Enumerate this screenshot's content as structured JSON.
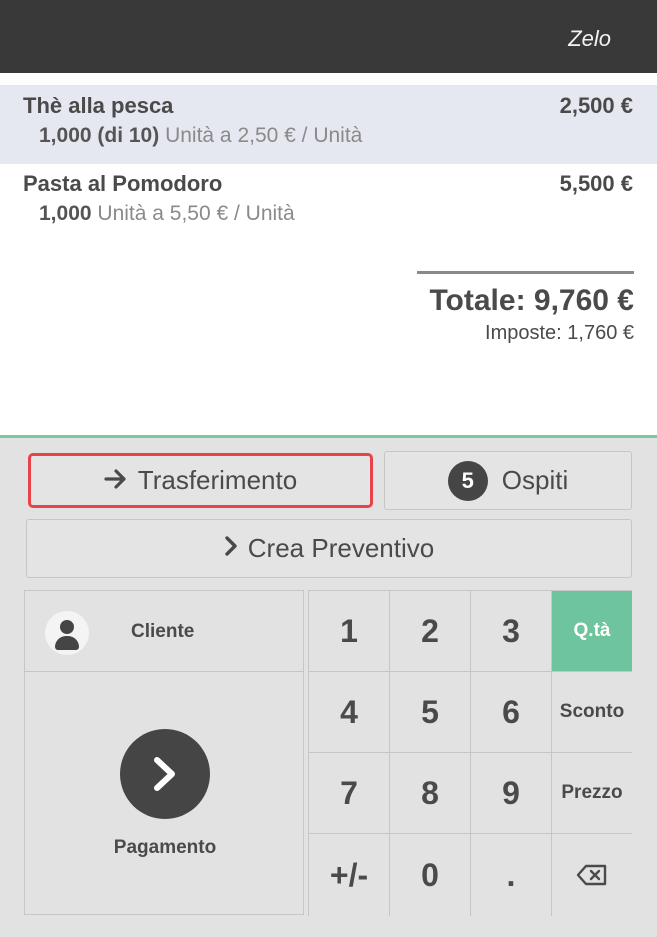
{
  "header": {
    "user": "Zelo"
  },
  "order": {
    "lines": [
      {
        "name": "Thè alla pesca",
        "price": "2,500 €",
        "qty": "1,000 (di 10)",
        "unit_info": "Unità a 2,50 € / Unità",
        "selected": true
      },
      {
        "name": "Pasta al Pomodoro",
        "price": "5,500 €",
        "qty": "1,000",
        "unit_info": "Unità a 5,50 € / Unità",
        "selected": false
      }
    ],
    "total": "Totale: 9,760 €",
    "taxes": "Imposte: 1,760 €"
  },
  "actions": {
    "transfer_label": "Trasferimento",
    "guests_count": "5",
    "guests_label": "Ospiti",
    "quote_label": "Crea Preventivo"
  },
  "customer": {
    "label": "Cliente"
  },
  "payment": {
    "label": "Pagamento"
  },
  "numpad": {
    "keys": [
      "1",
      "2",
      "3",
      "Q.tà",
      "4",
      "5",
      "6",
      "Sconto",
      "7",
      "8",
      "9",
      "Prezzo",
      "+/-",
      "0",
      ".",
      "⌫"
    ],
    "active_mode": "Q.tà"
  },
  "colors": {
    "accent": "#6ec49c",
    "highlight_border": "#e8434a",
    "header_bg": "#393939"
  }
}
